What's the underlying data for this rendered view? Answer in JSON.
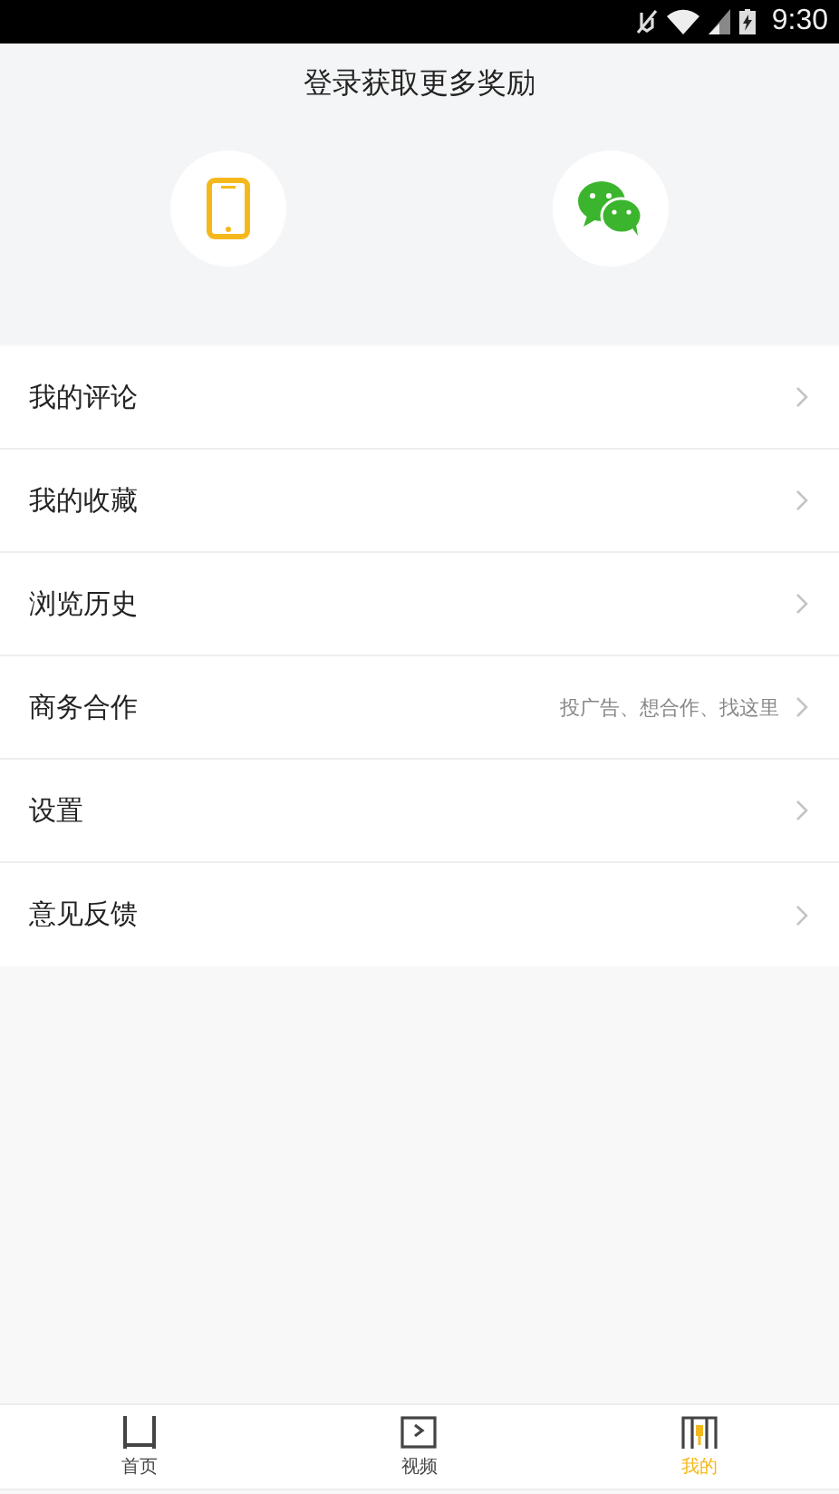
{
  "status_bar": {
    "time": "9:30"
  },
  "header": {
    "title": "登录获取更多奖励"
  },
  "menu": [
    {
      "label": "我的评论"
    },
    {
      "label": "我的收藏"
    },
    {
      "label": "浏览历史"
    },
    {
      "label": "商务合作",
      "hint": "投广告、想合作、找这里"
    },
    {
      "label": "设置"
    },
    {
      "label": "意见反馈"
    }
  ],
  "tabs": [
    {
      "label": "首页",
      "selected": false
    },
    {
      "label": "视频",
      "selected": false
    },
    {
      "label": "我的",
      "selected": true
    }
  ]
}
